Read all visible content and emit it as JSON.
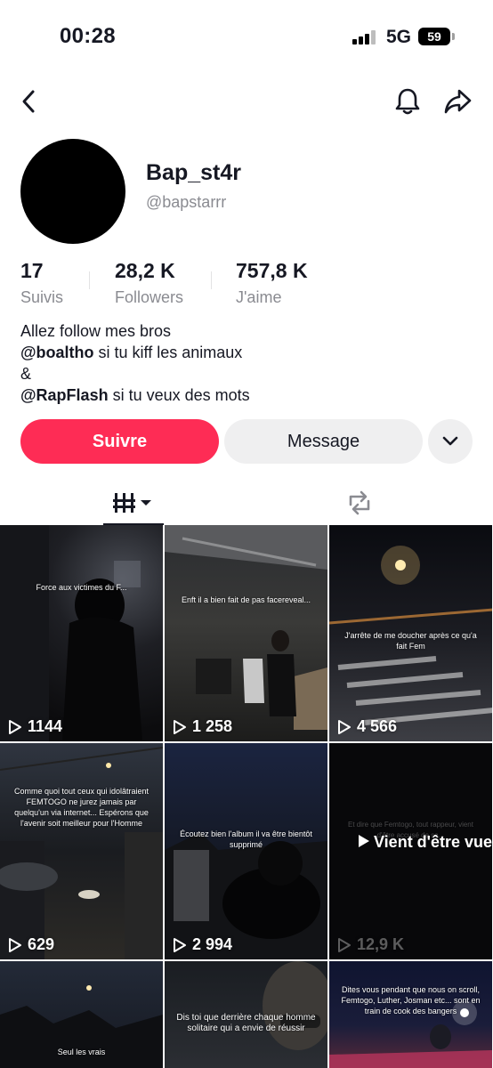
{
  "status_bar": {
    "time": "00:28",
    "network": "5G",
    "battery": "59"
  },
  "nav": {
    "back_icon": "chevron-left-icon",
    "bell_icon": "bell-icon",
    "share_icon": "share-arrow-icon"
  },
  "profile": {
    "display_name": "Bap_st4r",
    "username": "@bapstarrr",
    "stats": [
      {
        "value": "17",
        "label": "Suivis"
      },
      {
        "value": "28,2 K",
        "label": "Followers"
      },
      {
        "value": "757,8 K",
        "label": "J'aime"
      }
    ],
    "bio": {
      "line1": "Allez follow mes bros",
      "line2_mention": "@boaltho",
      "line2_text": " si tu kiff les animaux",
      "line3": "&",
      "line4_mention": "@RapFlash",
      "line4_text": " si tu veux des mots"
    }
  },
  "actions": {
    "follow_label": "Suivre",
    "message_label": "Message"
  },
  "tabs": {
    "videos_icon": "grid-icon",
    "reposts_icon": "repost-icon"
  },
  "colors": {
    "accent": "#fe2c55",
    "secondary_button": "#efeff0",
    "muted_text": "#8a8b91"
  },
  "videos": [
    {
      "caption": "Force aux victimes du F...",
      "views": "1144"
    },
    {
      "caption": "Enft il a bien fait de pas facereveal...",
      "views": "1 258"
    },
    {
      "caption": "J'arrête de me doucher après ce qu'a fait Fem",
      "views": "4 566"
    },
    {
      "caption": "Comme quoi tout ceux qui idolâtraient FEMTOGO ne jurez jamais par quelqu'un via internet... Espérons que l'avenir soit meilleur pour l'Homme",
      "views": "629"
    },
    {
      "caption": "Écoutez bien l'album il va être bientôt supprimé",
      "views": "2 994"
    },
    {
      "caption": "Et dire que Femtogo, tout rappeur, vient d'être accusé de sa...",
      "views": "12,9 K",
      "overlay": "Vient d'être vue"
    },
    {
      "caption": "Seul les vrais",
      "views": ""
    },
    {
      "caption": "Dis toi que derrière chaque homme solitaire qui a envie de réussir",
      "views": ""
    },
    {
      "caption": "Dites vous pendant que nous on scroll, Femtogo, Luther, Josman etc... sont en train de cook des bangers",
      "views": ""
    }
  ]
}
